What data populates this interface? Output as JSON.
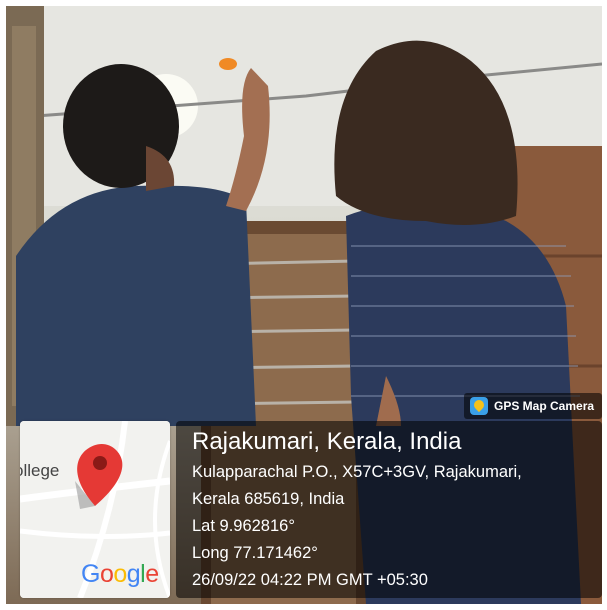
{
  "badge": {
    "label": "GPS Map Camera",
    "icon": "gps-map-camera-icon"
  },
  "map": {
    "place_label": "ollege",
    "logo_letters": [
      "G",
      "o",
      "o",
      "g",
      "l",
      "e"
    ],
    "pin_color": "#E53935"
  },
  "location": {
    "title": "Rajakumari, Kerala, India",
    "address_line1": "Kulapparachal P.O., X57C+3GV, Rajakumari,",
    "address_line2": "Kerala 685619, India",
    "latitude": "Lat 9.962816°",
    "longitude": "Long 77.171462°",
    "timestamp": "26/09/22 04:22 PM GMT +05:30"
  }
}
